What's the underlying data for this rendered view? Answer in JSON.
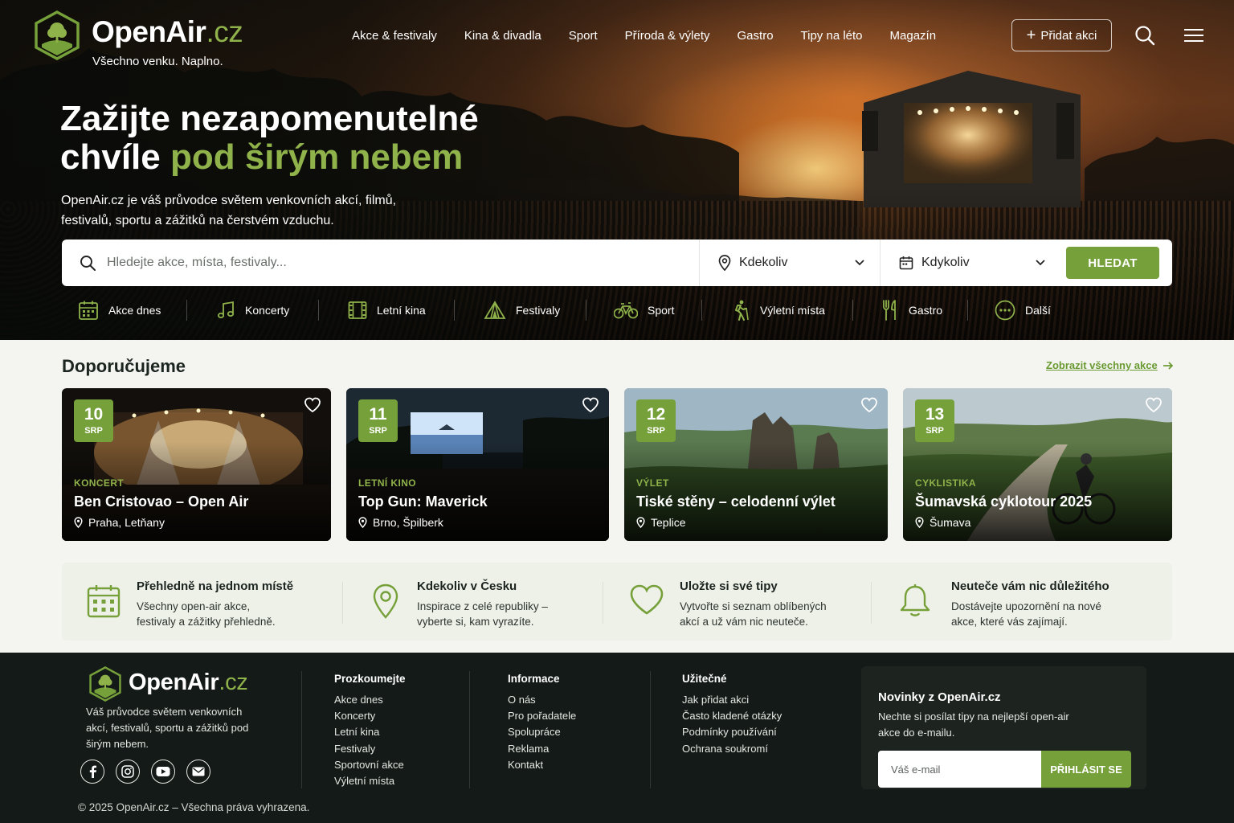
{
  "brand": {
    "name": "OpenAir",
    "tld": ".cz",
    "tagline": "Všechno venku. Naplno.",
    "accent_color": "#76a03a",
    "accent_light": "#8fb24a"
  },
  "nav": {
    "items": [
      "Akce & festivaly",
      "Kina & divadla",
      "Sport",
      "Příroda & výlety",
      "Gastro",
      "Tipy na léto",
      "Magazín"
    ],
    "add_label": "Přidat akci",
    "search_icon": "search-icon",
    "menu_icon": "hamburger-menu-icon"
  },
  "hero": {
    "title_line1": "Zažijte nezapomenutelné",
    "title_line2_plain": "chvíle ",
    "title_line2_accent": "pod širým nebem",
    "subtitle": "OpenAir.cz je váš průvodce světem venkovních akcí, filmů, festivalů, sportu a zážitků na čerstvém vzduchu."
  },
  "search": {
    "placeholder": "Hledejte akce, místa, festivaly...",
    "where": "Kdekoliv",
    "when": "Kdykoliv",
    "button": "HLEDAT"
  },
  "categories": [
    {
      "label": "Akce dnes",
      "icon": "calendar-icon"
    },
    {
      "label": "Koncerty",
      "icon": "music-note-icon"
    },
    {
      "label": "Letní kina",
      "icon": "film-icon"
    },
    {
      "label": "Festivaly",
      "icon": "tent-icon"
    },
    {
      "label": "Sport",
      "icon": "bicycle-icon"
    },
    {
      "label": "Výletní místa",
      "icon": "hiker-icon"
    },
    {
      "label": "Gastro",
      "icon": "cutlery-icon"
    },
    {
      "label": "Další",
      "icon": "more-icon"
    }
  ],
  "recommended": {
    "title": "Doporučujeme",
    "see_all": "Zobrazit všechny akce",
    "cards": [
      {
        "day": "10",
        "month": "SRP",
        "type": "KONCERT",
        "title": "Ben Cristovao – Open Air",
        "location": "Praha, Letňany"
      },
      {
        "day": "11",
        "month": "SRP",
        "type": "LETNÍ KINO",
        "title": "Top Gun: Maverick",
        "location": "Brno, Špilberk"
      },
      {
        "day": "12",
        "month": "SRP",
        "type": "VÝLET",
        "title": "Tiské stěny – celodenní výlet",
        "location": "Teplice"
      },
      {
        "day": "13",
        "month": "SRP",
        "type": "CYKLISTIKA",
        "title": "Šumavská cyklotour 2025",
        "location": "Šumava"
      }
    ]
  },
  "features": [
    {
      "title": "Přehledně na jednom místě",
      "line1": "Všechny open-air akce,",
      "line2": "festivaly a zážitky přehledně.",
      "icon": "calendar-icon"
    },
    {
      "title": "Kdekoliv v Česku",
      "line1": "Inspirace z celé republiky –",
      "line2": "vyberte si, kam vyrazíte.",
      "icon": "map-pin-icon"
    },
    {
      "title": "Uložte si své tipy",
      "line1": "Vytvořte si seznam oblíbených",
      "line2": "akcí a už vám nic neuteče.",
      "icon": "heart-icon"
    },
    {
      "title": "Neuteče vám nic důležitého",
      "line1": "Dostávejte upozornění na nové",
      "line2": "akce, které vás zajímají.",
      "icon": "bell-icon"
    }
  ],
  "footer": {
    "description": "Váš průvodce světem venkovních akcí, festivalů, sportu a zážitků pod širým nebem.",
    "columns": [
      {
        "title": "Prozkoumejte",
        "links": [
          "Akce dnes",
          "Koncerty",
          "Letní kina",
          "Festivaly",
          "Sportovní akce",
          "Výletní místa"
        ]
      },
      {
        "title": "Informace",
        "links": [
          "O nás",
          "Pro pořadatele",
          "Spolupráce",
          "Reklama",
          "Kontakt"
        ]
      },
      {
        "title": "Užitečné",
        "links": [
          "Jak přidat akci",
          "Často kladené otázky",
          "Podmínky používání",
          "Ochrana soukromí"
        ]
      }
    ],
    "newsletter": {
      "title": "Novinky z OpenAir.cz",
      "text": "Nechte si posílat tipy na nejlepší open-air akce do e-mailu.",
      "placeholder": "Váš e-mail",
      "button": "PŘIHLÁSIT SE"
    },
    "socials": [
      "facebook-icon",
      "instagram-icon",
      "youtube-icon",
      "email-icon"
    ],
    "copyright": "© 2025 OpenAir.cz – Všechna práva vyhrazena."
  }
}
